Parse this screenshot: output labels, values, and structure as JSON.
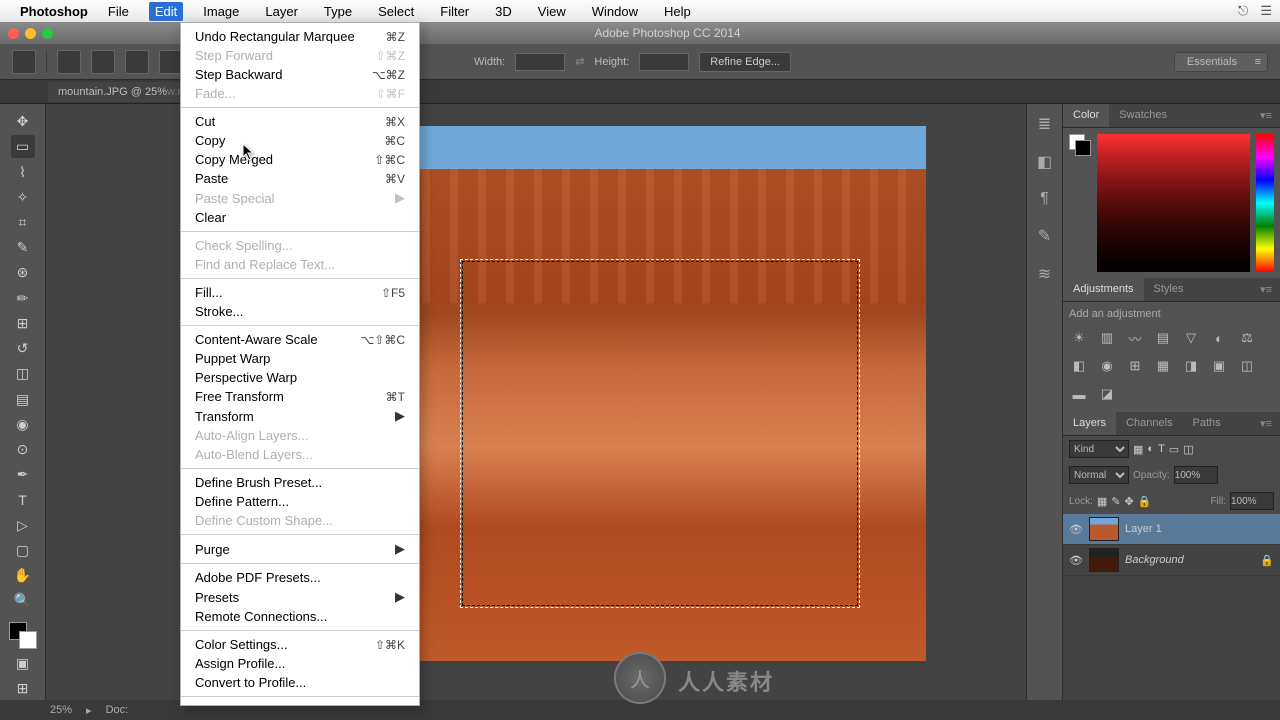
{
  "menubar": {
    "app": "Photoshop",
    "items": [
      "File",
      "Edit",
      "Image",
      "Layer",
      "Type",
      "Select",
      "Filter",
      "3D",
      "View",
      "Window",
      "Help"
    ],
    "active_index": 1
  },
  "window_title": "Adobe Photoshop CC 2014",
  "options_bar": {
    "width_label": "Width:",
    "height_label": "Height:",
    "refine_btn": "Refine Edge...",
    "workspace": "Essentials"
  },
  "doc_tab": {
    "label": "mountain.JPG @ 25%",
    "watermark_suffix": "w.rr-sc.com"
  },
  "edit_menu": [
    {
      "label": "Undo Rectangular Marquee",
      "shortcut": "⌘Z",
      "enabled": true
    },
    {
      "label": "Step Forward",
      "shortcut": "⇧⌘Z",
      "enabled": false
    },
    {
      "label": "Step Backward",
      "shortcut": "⌥⌘Z",
      "enabled": true
    },
    {
      "label": "Fade...",
      "shortcut": "⇧⌘F",
      "enabled": false
    },
    {
      "sep": true
    },
    {
      "label": "Cut",
      "shortcut": "⌘X",
      "enabled": true
    },
    {
      "label": "Copy",
      "shortcut": "⌘C",
      "enabled": true
    },
    {
      "label": "Copy Merged",
      "shortcut": "⇧⌘C",
      "enabled": true
    },
    {
      "label": "Paste",
      "shortcut": "⌘V",
      "enabled": true
    },
    {
      "label": "Paste Special",
      "submenu": true,
      "enabled": false
    },
    {
      "label": "Clear",
      "enabled": true
    },
    {
      "sep": true
    },
    {
      "label": "Check Spelling...",
      "enabled": false
    },
    {
      "label": "Find and Replace Text...",
      "enabled": false
    },
    {
      "sep": true
    },
    {
      "label": "Fill...",
      "shortcut": "⇧F5",
      "enabled": true
    },
    {
      "label": "Stroke...",
      "enabled": true
    },
    {
      "sep": true
    },
    {
      "label": "Content-Aware Scale",
      "shortcut": "⌥⇧⌘C",
      "enabled": true
    },
    {
      "label": "Puppet Warp",
      "enabled": true
    },
    {
      "label": "Perspective Warp",
      "enabled": true
    },
    {
      "label": "Free Transform",
      "shortcut": "⌘T",
      "enabled": true
    },
    {
      "label": "Transform",
      "submenu": true,
      "enabled": true
    },
    {
      "label": "Auto-Align Layers...",
      "enabled": false
    },
    {
      "label": "Auto-Blend Layers...",
      "enabled": false
    },
    {
      "sep": true
    },
    {
      "label": "Define Brush Preset...",
      "enabled": true
    },
    {
      "label": "Define Pattern...",
      "enabled": true
    },
    {
      "label": "Define Custom Shape...",
      "enabled": false
    },
    {
      "sep": true
    },
    {
      "label": "Purge",
      "submenu": true,
      "enabled": true
    },
    {
      "sep": true
    },
    {
      "label": "Adobe PDF Presets...",
      "enabled": true
    },
    {
      "label": "Presets",
      "submenu": true,
      "enabled": true
    },
    {
      "label": "Remote Connections...",
      "enabled": true
    },
    {
      "sep": true
    },
    {
      "label": "Color Settings...",
      "shortcut": "⇧⌘K",
      "enabled": true
    },
    {
      "label": "Assign Profile...",
      "enabled": true
    },
    {
      "label": "Convert to Profile...",
      "enabled": true
    },
    {
      "sep": true
    }
  ],
  "panels": {
    "color_tab": "Color",
    "swatches_tab": "Swatches",
    "adjustments_tab": "Adjustments",
    "styles_tab": "Styles",
    "add_adjustment_label": "Add an adjustment",
    "layers_tab": "Layers",
    "channels_tab": "Channels",
    "paths_tab": "Paths",
    "kind_label": "Kind",
    "blend_mode": "Normal",
    "opacity_label": "Opacity:",
    "opacity_value": "100%",
    "lock_label": "Lock:",
    "fill_label": "Fill:",
    "fill_value": "100%",
    "layers": [
      {
        "name": "Layer 1",
        "selected": true,
        "locked": false,
        "visible": true
      },
      {
        "name": "Background",
        "selected": false,
        "locked": true,
        "visible": true,
        "italic": true
      }
    ]
  },
  "status": {
    "zoom": "25%",
    "doc": "Doc:"
  },
  "tools": [
    "move",
    "marquee",
    "lasso",
    "wand",
    "crop",
    "eyedropper",
    "spot-heal",
    "brush",
    "clone",
    "history-brush",
    "eraser",
    "gradient",
    "blur",
    "dodge",
    "pen",
    "type",
    "path-select",
    "rectangle",
    "hand",
    "zoom"
  ],
  "watermark_text": "人人素材"
}
